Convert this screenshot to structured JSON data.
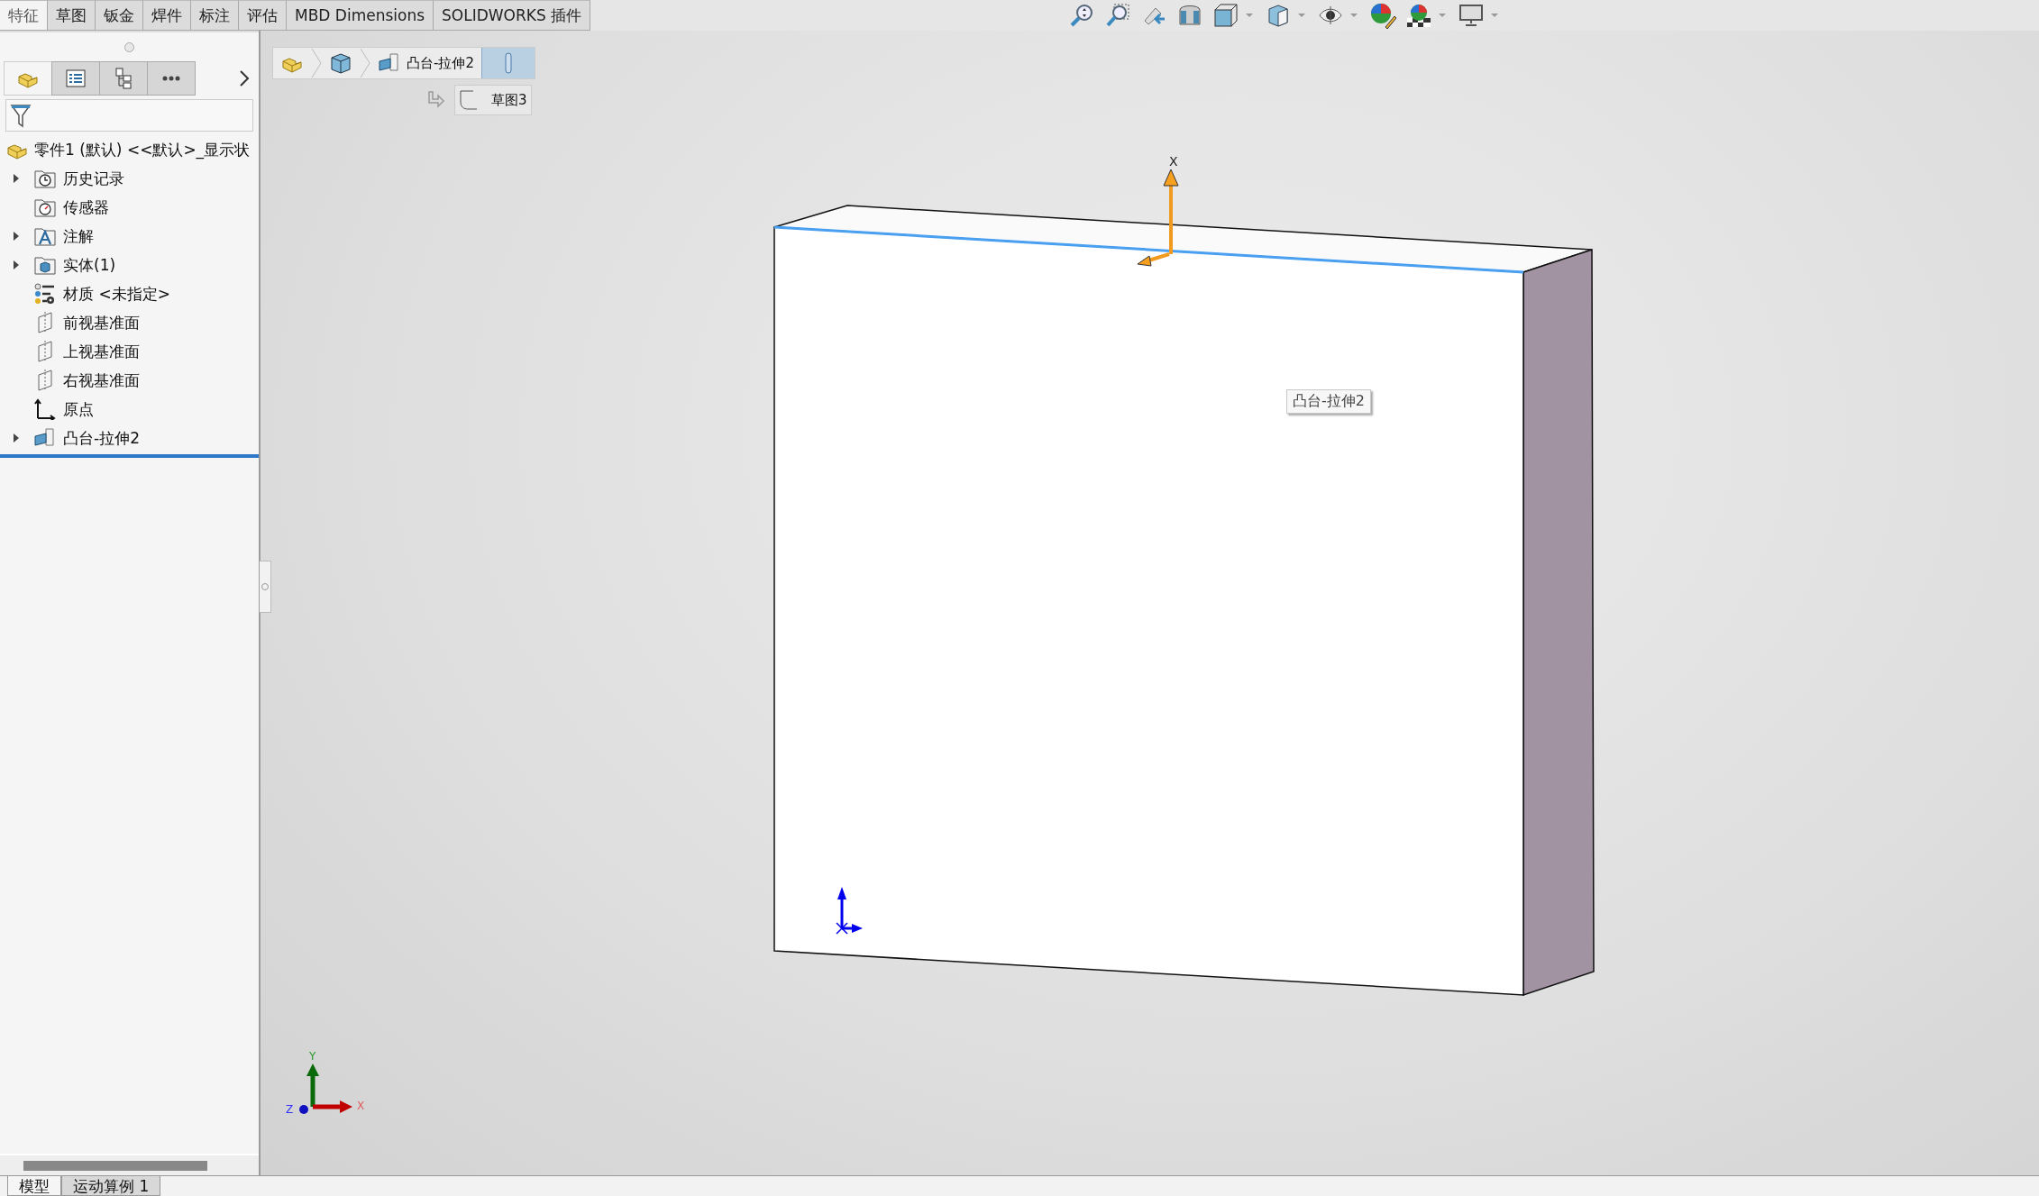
{
  "command_tabs": [
    {
      "label": "特征",
      "selected": true
    },
    {
      "label": "草图",
      "selected": false
    },
    {
      "label": "钣金",
      "selected": false
    },
    {
      "label": "焊件",
      "selected": false
    },
    {
      "label": "标注",
      "selected": false
    },
    {
      "label": "评估",
      "selected": false
    },
    {
      "label": "MBD Dimensions",
      "selected": false
    },
    {
      "label": "SOLIDWORKS 插件",
      "selected": false
    }
  ],
  "manager_tabs": [
    {
      "kind": "feature",
      "selected": true
    },
    {
      "kind": "property",
      "selected": false
    },
    {
      "kind": "config",
      "selected": false
    },
    {
      "kind": "more",
      "selected": false
    }
  ],
  "tree": {
    "root": {
      "label": "零件1 (默认) <<默认>_显示状"
    },
    "items": [
      {
        "label": "历史记录",
        "kind": "history",
        "expandable": true
      },
      {
        "label": "传感器",
        "kind": "sensor",
        "expandable": false
      },
      {
        "label": "注解",
        "kind": "annotation",
        "expandable": true
      },
      {
        "label": "实体(1)",
        "kind": "solid",
        "expandable": true
      },
      {
        "label": "材质 <未指定>",
        "kind": "material",
        "expandable": false
      },
      {
        "label": "前视基准面",
        "kind": "plane",
        "expandable": false
      },
      {
        "label": "上视基准面",
        "kind": "plane",
        "expandable": false
      },
      {
        "label": "右视基准面",
        "kind": "plane",
        "expandable": false
      },
      {
        "label": "原点",
        "kind": "origin",
        "expandable": false
      },
      {
        "label": "凸台-拉伸2",
        "kind": "extrude",
        "expandable": true
      }
    ]
  },
  "breadcrumb": {
    "feature": "凸台-拉伸2",
    "sketch": "草图3"
  },
  "viewport": {
    "tooltip": "凸台-拉伸2",
    "triad_label": "X",
    "axis_labels": {
      "y": "Y",
      "x": "X",
      "z": "Z"
    }
  },
  "bottom_tabs": [
    {
      "label": "模型",
      "selected": true
    },
    {
      "label": "运动算例 1",
      "selected": false
    }
  ]
}
